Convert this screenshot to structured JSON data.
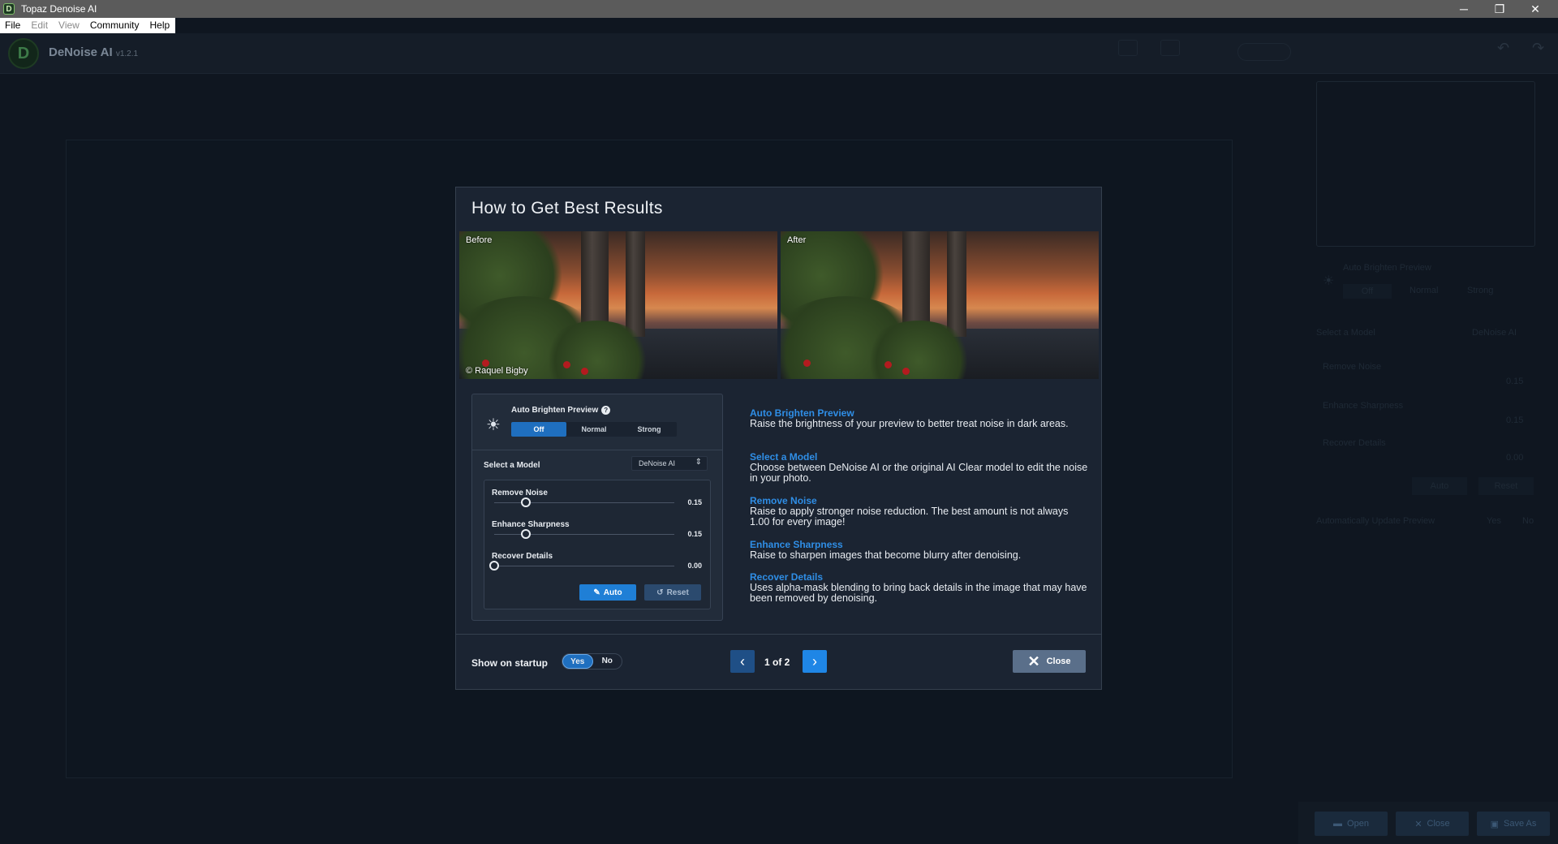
{
  "window": {
    "title": "Topaz Denoise AI",
    "app_icon_glyph": "D",
    "controls": {
      "minimize": "─",
      "restore": "❐",
      "close": "✕"
    }
  },
  "menu": [
    "File",
    "Edit",
    "View",
    "Community",
    "Help"
  ],
  "header": {
    "logo_glyph": "D",
    "app_name": "DeNoise AI",
    "version": "v1.2.1"
  },
  "modal": {
    "title": "How to Get Best Results",
    "before_label": "Before",
    "after_label": "After",
    "credit": "© Raquel Bigby",
    "mock_panel": {
      "auto_brighten_label": "Auto Brighten Preview",
      "help_glyph": "?",
      "brighten_options": [
        "Off",
        "Normal",
        "Strong"
      ],
      "brighten_selected": "Off",
      "select_model_label": "Select a Model",
      "model_value": "DeNoise AI",
      "sliders": [
        {
          "label": "Remove Noise",
          "value": "0.15",
          "level": 0.15
        },
        {
          "label": "Enhance Sharpness",
          "value": "0.15",
          "level": 0.15
        },
        {
          "label": "Recover Details",
          "value": "0.00",
          "level": 0.0
        }
      ],
      "auto_label": "Auto",
      "reset_label": "Reset"
    },
    "help_items": [
      {
        "heading": "Auto Brighten Preview",
        "text": "Raise the brightness of your preview to better treat noise in dark areas."
      },
      {
        "heading": "Select a Model",
        "text": "Choose between DeNoise AI or the original AI Clear model to edit the noise in your photo."
      },
      {
        "heading": "Remove Noise",
        "text": "Raise to apply stronger noise reduction. The best amount is not always 1.00 for every image!"
      },
      {
        "heading": "Enhance Sharpness",
        "text": "Raise to sharpen images that become blurry after denoising."
      },
      {
        "heading": "Recover Details",
        "text": "Uses alpha-mask blending to bring back details in the image that may have been removed by denoising."
      }
    ],
    "footer": {
      "show_on_startup_label": "Show on startup",
      "yes_label": "Yes",
      "no_label": "No",
      "startup_selected": "Yes",
      "page_text": "1 of 2",
      "prev_glyph": "‹",
      "next_glyph": "›",
      "close_label": "Close",
      "close_glyph": "✕"
    }
  },
  "background_panel": {
    "auto_brighten_label": "Auto Brighten Preview",
    "brighten_options": [
      "Off",
      "Normal",
      "Strong"
    ],
    "select_model_label": "Select a Model",
    "model_value": "DeNoise AI",
    "sliders": [
      {
        "label": "Remove Noise",
        "value": "0.15"
      },
      {
        "label": "Enhance Sharpness",
        "value": "0.15"
      },
      {
        "label": "Recover Details",
        "value": "0.00"
      }
    ],
    "auto_label": "Auto",
    "reset_label": "Reset",
    "auto_update_label": "Automatically Update Preview",
    "yes_label": "Yes",
    "no_label": "No"
  },
  "bottom_bar": {
    "open_label": "Open",
    "close_label": "Close",
    "save_as_label": "Save As"
  },
  "colors": {
    "accent": "#1f86e6",
    "link_heading": "#2f8ee6",
    "modal_bg": "#1b2432"
  },
  "icons": [
    "app-icon",
    "logo-icon",
    "sun-icon",
    "help-icon",
    "wand-icon",
    "reset-icon",
    "chevron-left-icon",
    "chevron-right-icon",
    "close-icon",
    "folder-icon",
    "save-icon"
  ]
}
